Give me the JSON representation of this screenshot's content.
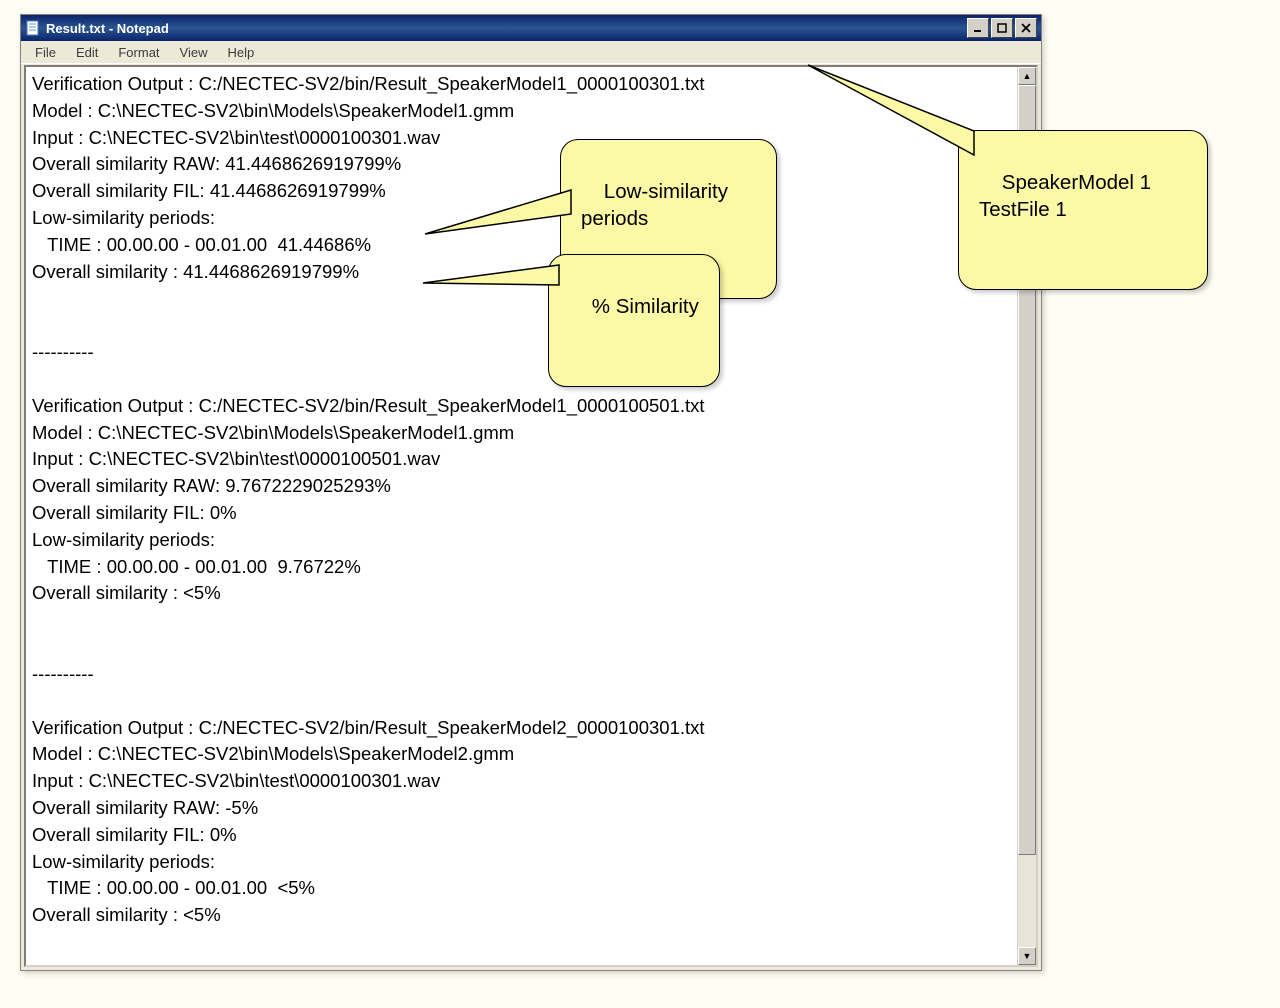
{
  "window": {
    "title": "Result.txt - Notepad"
  },
  "menu": {
    "file": "File",
    "edit": "Edit",
    "format": "Format",
    "view": "View",
    "help": "Help"
  },
  "content": {
    "block1": {
      "l1": "Verification Output : C:/NECTEC-SV2/bin/Result_SpeakerModel1_0000100301.txt",
      "l2": "Model : C:\\NECTEC-SV2\\bin\\Models\\SpeakerModel1.gmm",
      "l3": "Input : C:\\NECTEC-SV2\\bin\\test\\0000100301.wav",
      "l4": "Overall similarity RAW: 41.4468626919799%",
      "l5": "Overall similarity FIL: 41.4468626919799%",
      "l6": "Low-similarity periods:",
      "l7": "   TIME : 00.00.00 - 00.01.00  41.44686%",
      "l8": "Overall similarity : 41.4468626919799%"
    },
    "sep": "----------",
    "block2": {
      "l1": "Verification Output : C:/NECTEC-SV2/bin/Result_SpeakerModel1_0000100501.txt",
      "l2": "Model : C:\\NECTEC-SV2\\bin\\Models\\SpeakerModel1.gmm",
      "l3": "Input : C:\\NECTEC-SV2\\bin\\test\\0000100501.wav",
      "l4": "Overall similarity RAW: 9.7672229025293%",
      "l5": "Overall similarity FIL: 0%",
      "l6": "Low-similarity periods:",
      "l7": "   TIME : 00.00.00 - 00.01.00  9.76722%",
      "l8": "Overall similarity : <5%"
    },
    "block3": {
      "l1": "Verification Output : C:/NECTEC-SV2/bin/Result_SpeakerModel2_0000100301.txt",
      "l2": "Model : C:\\NECTEC-SV2\\bin\\Models\\SpeakerModel2.gmm",
      "l3": "Input : C:\\NECTEC-SV2\\bin\\test\\0000100301.wav",
      "l4": "Overall similarity RAW: -5%",
      "l5": "Overall similarity FIL: 0%",
      "l6": "Low-similarity periods:",
      "l7": "   TIME : 00.00.00 - 00.01.00  <5%",
      "l8": "Overall similarity : <5%"
    }
  },
  "callouts": {
    "c1": "Low-similarity\nperiods",
    "c2": "% Similarity",
    "c3": "SpeakerModel 1\nTestFile 1"
  }
}
